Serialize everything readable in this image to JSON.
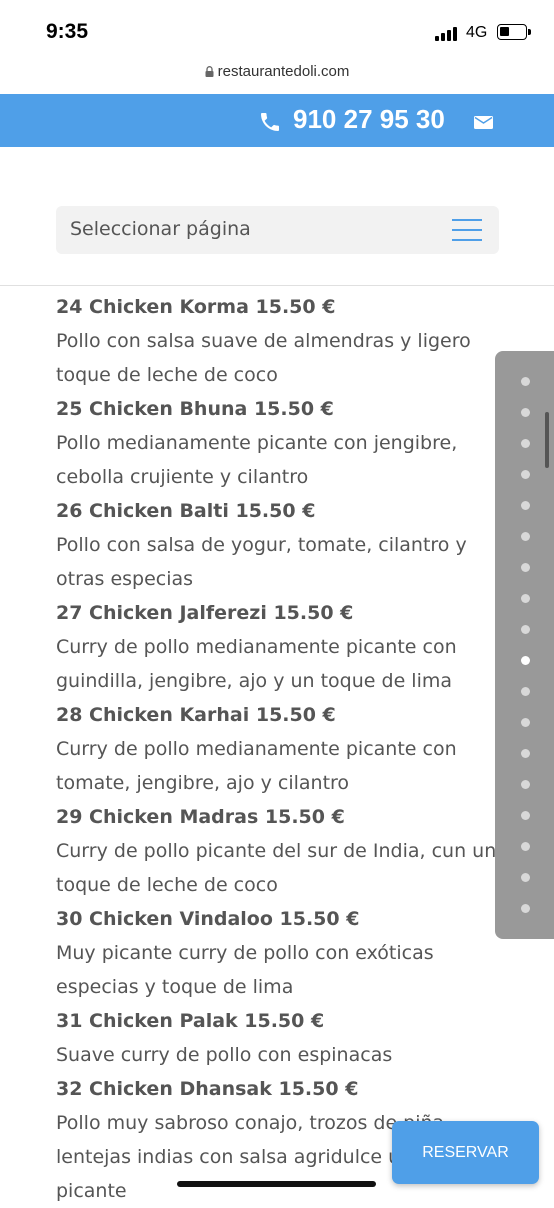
{
  "status_bar": {
    "time": "9:35",
    "network": "4G"
  },
  "browser": {
    "url": "restaurantedoli.com"
  },
  "header": {
    "phone": "910 27 95 30"
  },
  "nav": {
    "select_label": "Seleccionar página"
  },
  "menu": [
    {
      "title": "24 Chicken Korma 15.50 €",
      "description": "Pollo con salsa suave de almendras y ligero toque de leche de coco"
    },
    {
      "title": "25 Chicken Bhuna 15.50 €",
      "description": "Pollo medianamente picante con jengibre, cebolla crujiente y cilantro"
    },
    {
      "title": "26 Chicken Balti 15.50 €",
      "description": "Pollo con salsa de yogur, tomate, cilantro y otras especias"
    },
    {
      "title": "27 Chicken Jalferezi 15.50 €",
      "description": "Curry de pollo medianamente picante con guindilla, jengibre, ajo y un toque de lima"
    },
    {
      "title": "28 Chicken Karhai 15.50 €",
      "description": "Curry de pollo medianamente picante con tomate, jengibre, ajo y cilantro"
    },
    {
      "title": "29 Chicken Madras 15.50 €",
      "description": "Curry de pollo picante del sur de India, cun un toque de leche de coco"
    },
    {
      "title": "30 Chicken Vindaloo 15.50 €",
      "description": "Muy picante curry de pollo con exóticas especias y toque de lima"
    },
    {
      "title": "31 Chicken Palak 15.50 €",
      "description": "Suave curry de pollo con espinacas"
    },
    {
      "title": "32 Chicken Dhansak 15.50 €",
      "description": "Pollo muy sabroso conajo, trozos de piña, lentejas indias con salsa agridulce un poco picante"
    }
  ],
  "dot_nav": {
    "count": 18,
    "active_index": 9
  },
  "cta": {
    "reserve_label": "RESERVAR"
  },
  "colors": {
    "accent": "#4f9fe8",
    "text": "#555555"
  }
}
